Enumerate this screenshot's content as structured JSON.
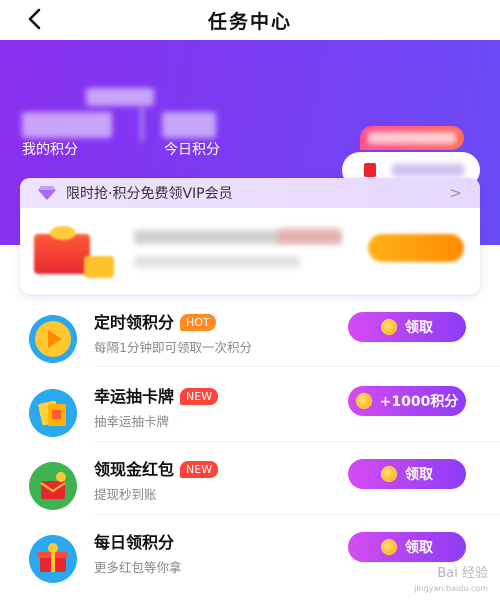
{
  "header": {
    "title": "任务中心",
    "back_icon": "back-arrow-icon"
  },
  "stats": {
    "points_label": "我的积分",
    "today_label": "今日积分"
  },
  "vip": {
    "title": "限时抢·积分免费领VIP会员",
    "arrow": ">"
  },
  "tasks": [
    {
      "title": "定时领积分",
      "badge": "HOT",
      "badge_type": "hot",
      "subtitle": "每隔1分钟即可领取一次积分",
      "button": "领取",
      "icon": "play-icon"
    },
    {
      "title": "幸运抽卡牌",
      "badge": "NEW",
      "badge_type": "new",
      "subtitle": "抽幸运抽卡牌",
      "button": "+1000积分",
      "icon": "cards-icon"
    },
    {
      "title": "领现金红包",
      "badge": "NEW",
      "badge_type": "new",
      "subtitle": "提现秒到账",
      "button": "领取",
      "icon": "red-envelope-icon"
    },
    {
      "title": "每日领积分",
      "badge": "",
      "badge_type": "",
      "subtitle": "更多红包等你拿",
      "button": "领取",
      "icon": "gift-box-icon"
    }
  ],
  "watermark": {
    "line1": "Bai 经验",
    "line2": "jingyan.baidu.com"
  },
  "colors": {
    "purple": "#7a3cf3",
    "button_gradient_start": "#d54cf2",
    "button_gradient_end": "#8d3cf5",
    "hot": "#ff8a1f",
    "new": "#ff4338"
  }
}
